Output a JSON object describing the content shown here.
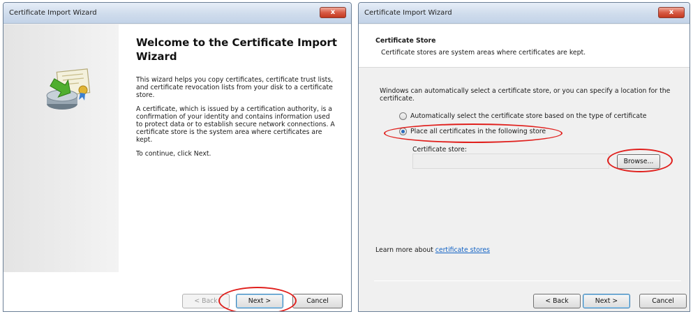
{
  "left_window": {
    "title": "Certificate Import Wizard",
    "close_label": "x",
    "heading": "Welcome to the Certificate Import Wizard",
    "paragraph1": "This wizard helps you copy certificates, certificate trust lists, and certificate revocation lists from your disk to a certificate store.",
    "paragraph2": "A certificate, which is issued by a certification authority, is a confirmation of your identity and contains information used to protect data or to establish secure network connections. A certificate store is the system area where certificates are kept.",
    "paragraph3": "To continue, click Next.",
    "back_label": "< Back",
    "next_label": "Next >",
    "cancel_label": "Cancel"
  },
  "right_window": {
    "title": "Certificate Import Wizard",
    "close_label": "x",
    "section_title": "Certificate Store",
    "section_desc": "Certificate stores are system areas where certificates are kept.",
    "explanation": "Windows can automatically select a certificate store, or you can specify a location for the certificate.",
    "option_auto": "Automatically select the certificate store based on the type of certificate",
    "option_place": "Place all certificates in the following store",
    "selected_option": "place",
    "store_label": "Certificate store:",
    "store_value": "",
    "browse_label": "Browse...",
    "learn_prefix": "Learn more about ",
    "learn_link": "certificate stores",
    "back_label": "< Back",
    "next_label": "Next >",
    "cancel_label": "Cancel"
  },
  "annotation_color": "#e0201d"
}
